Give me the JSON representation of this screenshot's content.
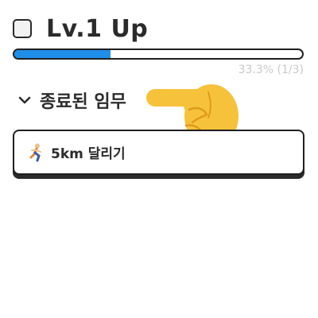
{
  "header": {
    "title": "Lv.1 Up",
    "checkbox_checked": false
  },
  "progress": {
    "fraction": 0.333,
    "label": "33.3% (1/3)"
  },
  "section": {
    "title": "종료된 임무",
    "collapse_icon": "chevron-down-icon"
  },
  "quests": [
    {
      "icon": "runner-icon",
      "label": "5km 달리기"
    }
  ],
  "colors": {
    "progress": "#1f8ee8",
    "hand": "#f6c23b",
    "text": "#2b2b2b",
    "muted": "#c9c9c9"
  }
}
